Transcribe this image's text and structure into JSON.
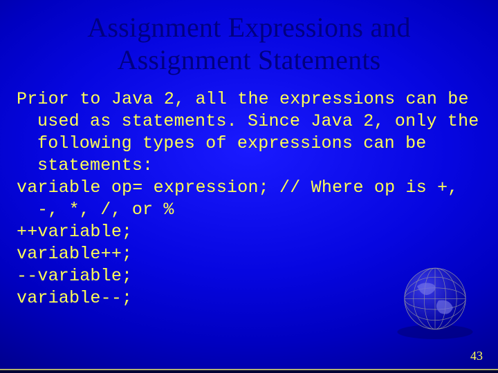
{
  "title_line1": "Assignment Expressions and",
  "title_line2": "Assignment Statements",
  "body": {
    "p1": "Prior to Java 2, all the expressions can be used as statements. Since Java 2, only the following types of expressions can be statements:",
    "p2": "variable op= expression; // Where op is +, -, *, /, or %",
    "l1": "++variable;",
    "l2": "variable++;",
    "l3": "--variable;",
    "l4": "variable--;"
  },
  "page_number": "43"
}
